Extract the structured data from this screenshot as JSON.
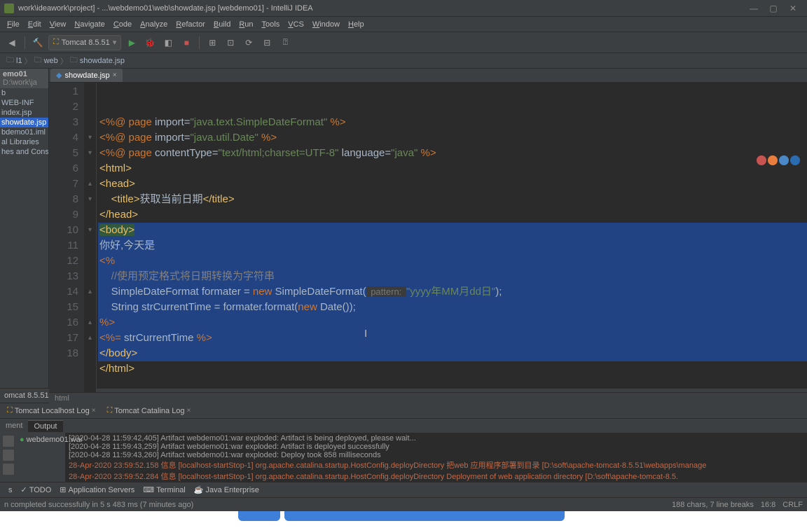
{
  "titlebar": {
    "title": "work\\ideawork\\project] - ...\\webdemo01\\web\\showdate.jsp [webdemo01] - IntelliJ IDEA"
  },
  "menu": {
    "items": [
      "File",
      "Edit",
      "View",
      "Navigate",
      "Code",
      "Analyze",
      "Refactor",
      "Build",
      "Run",
      "Tools",
      "VCS",
      "Window",
      "Help"
    ]
  },
  "toolbar": {
    "run_config": "Tomcat 8.5.51"
  },
  "breadcrumb": {
    "parts": [
      "l1",
      "web",
      "showdate.jsp"
    ]
  },
  "project": {
    "title": "emo01",
    "path": "D:\\work\\ja",
    "nodes": [
      "b",
      "WEB-INF",
      "index.jsp",
      "showdate.jsp",
      "bdemo01.iml",
      "al Libraries",
      "hes and Consoles"
    ],
    "selected_index": 3
  },
  "tab": {
    "name": "showdate.jsp"
  },
  "gutter": {
    "start": 1,
    "end": 18
  },
  "code": {
    "crumb": "html"
  },
  "code_lines": [
    {
      "n": 1,
      "seg": [
        [
          "<%@ ",
          "kw"
        ],
        [
          "page",
          "kw"
        ],
        [
          " import=",
          "txt"
        ],
        [
          "\"java.text.SimpleDateFormat\"",
          "str"
        ],
        [
          " %>",
          "kw"
        ]
      ]
    },
    {
      "n": 2,
      "seg": [
        [
          "<%@ ",
          "kw"
        ],
        [
          "page",
          "kw"
        ],
        [
          " import=",
          "txt"
        ],
        [
          "\"java.util.Date\"",
          "str"
        ],
        [
          " %>",
          "kw"
        ]
      ]
    },
    {
      "n": 3,
      "seg": [
        [
          "<%@ ",
          "kw"
        ],
        [
          "page",
          "kw"
        ],
        [
          " contentType=",
          "txt"
        ],
        [
          "\"text/html;charset=UTF-8\"",
          "str"
        ],
        [
          " language=",
          "txt"
        ],
        [
          "\"java\"",
          "str"
        ],
        [
          " %>",
          "kw"
        ]
      ]
    },
    {
      "n": 4,
      "seg": [
        [
          "<html>",
          "tag"
        ]
      ]
    },
    {
      "n": 5,
      "seg": [
        [
          "<head>",
          "tag"
        ]
      ]
    },
    {
      "n": 6,
      "seg": [
        [
          "    ",
          "txt"
        ],
        [
          "<title>",
          "tag"
        ],
        [
          "获取当前日期",
          "txt"
        ],
        [
          "</title>",
          "tag"
        ]
      ]
    },
    {
      "n": 7,
      "seg": [
        [
          "</head>",
          "tag"
        ]
      ]
    },
    {
      "n": 8,
      "sel": true,
      "seg": [
        [
          "<body>",
          "tag",
          "hl"
        ]
      ]
    },
    {
      "n": 9,
      "sel": true,
      "seg": [
        [
          "你好,今天是",
          "txt"
        ]
      ]
    },
    {
      "n": 10,
      "sel": true,
      "seg": [
        [
          "<%",
          "kw"
        ]
      ]
    },
    {
      "n": 11,
      "sel": true,
      "seg": [
        [
          "    //使用预定格式将日期转换为字符串",
          "cmt"
        ]
      ]
    },
    {
      "n": 12,
      "sel": true,
      "seg": [
        [
          "    SimpleDateFormat ",
          "type"
        ],
        [
          "formater",
          "txt"
        ],
        [
          " = ",
          "txt"
        ],
        [
          "new ",
          "kw"
        ],
        [
          "SimpleDateFormat(",
          "type"
        ],
        [
          " pattern: ",
          "hint"
        ],
        [
          "\"yyyy年MM月dd日\"",
          "str"
        ],
        [
          ");",
          "txt"
        ]
      ]
    },
    {
      "n": 13,
      "sel": true,
      "seg": [
        [
          "    String strCurrentTime = formater.format(",
          "txt"
        ],
        [
          "new ",
          "kw"
        ],
        [
          "Date());",
          "txt"
        ]
      ]
    },
    {
      "n": 14,
      "sel": true,
      "seg": [
        [
          "%>",
          "kw"
        ]
      ]
    },
    {
      "n": 15,
      "sel": true,
      "seg": [
        [
          "<%= ",
          "kw"
        ],
        [
          "strCurrentTime ",
          "txt"
        ],
        [
          "%>",
          "kw"
        ]
      ]
    },
    {
      "n": 16,
      "sel": true,
      "seg": [
        [
          "</body>",
          "tag"
        ]
      ]
    },
    {
      "n": 17,
      "seg": [
        [
          "</html>",
          "tag"
        ]
      ]
    },
    {
      "n": 18,
      "seg": [
        [
          "",
          "txt"
        ]
      ]
    }
  ],
  "run": {
    "title": "omcat 8.5.51",
    "tabs": [
      "Tomcat Localhost Log",
      "Tomcat Catalina Log"
    ],
    "inner_tabs": [
      "ment",
      "Output"
    ],
    "server_node": "webdemo01:war",
    "console": [
      {
        "t": "[2020-04-28 11:59:42,405] Artifact webdemo01:war exploded: Artifact is being deployed, please wait...",
        "c": "n"
      },
      {
        "t": "[2020-04-28 11:59:43,259] Artifact webdemo01:war exploded: Artifact is deployed successfully",
        "c": "n"
      },
      {
        "t": "[2020-04-28 11:59:43,260] Artifact webdemo01:war exploded: Deploy took 858 milliseconds",
        "c": "n"
      },
      {
        "t": "28-Apr-2020 23:59:52.158 信息 [localhost-startStop-1] org.apache.catalina.startup.HostConfig.deployDirectory 把web 应用程序部署到目录 [D:\\soft\\apache-tomcat-8.5.51\\webapps\\manage",
        "c": "w"
      },
      {
        "t": "28-Apr-2020 23:59:52.284 信息 [localhost-startStop-1] org.apache.catalina.startup.HostConfig.deployDirectory Deployment of web application directory [D:\\soft\\apache-tomcat-8.5.",
        "c": "w"
      }
    ]
  },
  "status": {
    "buttons": [
      "s",
      "TODO",
      "Application Servers",
      "Terminal",
      "Java Enterprise"
    ],
    "msg": "n completed successfully in 5 s 483 ms (7 minutes ago)",
    "right": [
      "188 chars, 7 line breaks",
      "16:8",
      "CRLF"
    ]
  }
}
